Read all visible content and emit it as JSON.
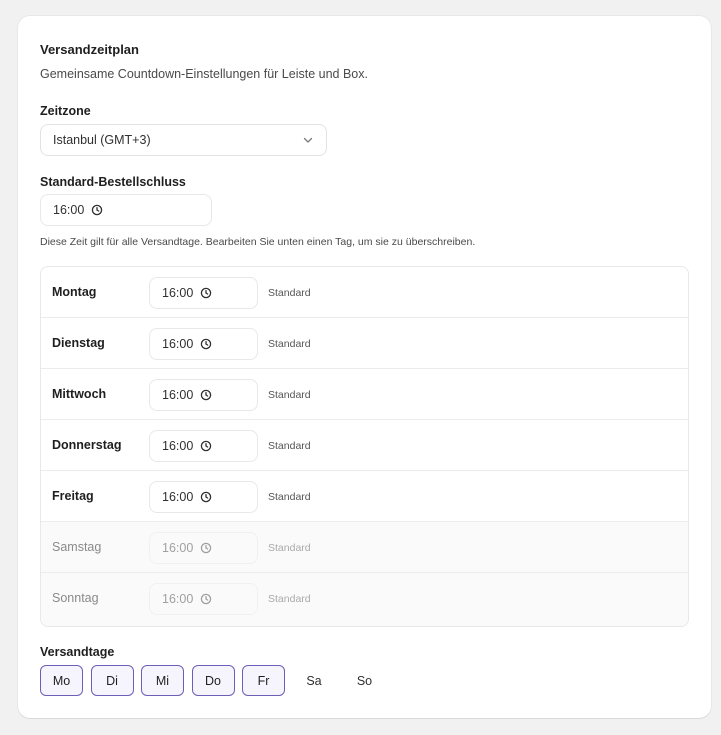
{
  "section": {
    "title": "Versandzeitplan",
    "subtitle": "Gemeinsame Countdown-Einstellungen für Leiste und Box."
  },
  "timezone": {
    "label": "Zeitzone",
    "value": "Istanbul (GMT+3)"
  },
  "default_cutoff": {
    "label": "Standard-Bestellschluss",
    "value": "16:00",
    "help": "Diese Zeit gilt für alle Versandtage. Bearbeiten Sie unten einen Tag, um sie zu überschreiben."
  },
  "schedule": [
    {
      "day": "Montag",
      "time": "16:00",
      "note": "Standard",
      "enabled": true
    },
    {
      "day": "Dienstag",
      "time": "16:00",
      "note": "Standard",
      "enabled": true
    },
    {
      "day": "Mittwoch",
      "time": "16:00",
      "note": "Standard",
      "enabled": true
    },
    {
      "day": "Donnerstag",
      "time": "16:00",
      "note": "Standard",
      "enabled": true
    },
    {
      "day": "Freitag",
      "time": "16:00",
      "note": "Standard",
      "enabled": true
    },
    {
      "day": "Samstag",
      "time": "16:00",
      "note": "Standard",
      "enabled": false
    },
    {
      "day": "Sonntag",
      "time": "16:00",
      "note": "Standard",
      "enabled": false
    }
  ],
  "shipping_days": {
    "label": "Versandtage",
    "days": [
      {
        "label": "Mo",
        "selected": true
      },
      {
        "label": "Di",
        "selected": true
      },
      {
        "label": "Mi",
        "selected": true
      },
      {
        "label": "Do",
        "selected": true
      },
      {
        "label": "Fr",
        "selected": true
      },
      {
        "label": "Sa",
        "selected": false
      },
      {
        "label": "So",
        "selected": false
      }
    ]
  },
  "colors": {
    "accent": "#6b5fb8",
    "accent_bg": "#f6f5fd"
  }
}
